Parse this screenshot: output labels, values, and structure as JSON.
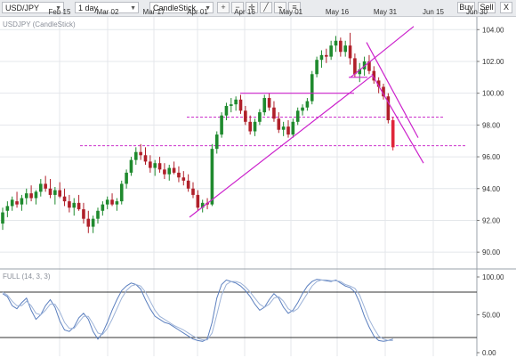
{
  "toolbar": {
    "symbol": "USD/JPY",
    "interval": "1 day",
    "chart_type": "CandleStick",
    "buy_label": "Buy",
    "sell_label": "Sell",
    "close_label": "X"
  },
  "chart_data": [
    {
      "type": "candlestick",
      "title": "USDJPY (CandleStick)",
      "x_tick_labels": [
        "Feb 15",
        "Mar 02",
        "Mar 17",
        "Apr 01",
        "Apr 16",
        "May 01",
        "May 16",
        "May 31",
        "Jun 15",
        "Jun 30"
      ],
      "y_tick_labels": [
        "104.00",
        "102.00",
        "100.00",
        "98.00",
        "96.00",
        "94.00",
        "92.00",
        "90.00"
      ],
      "ylim": [
        89,
        104.8
      ],
      "grid": true,
      "candles": [
        [
          91.8,
          92.8,
          91.4,
          92.5
        ],
        [
          92.6,
          93.2,
          92.2,
          92.9
        ],
        [
          92.9,
          93.5,
          92.6,
          93.3
        ],
        [
          93.2,
          93.8,
          92.8,
          93.0
        ],
        [
          93.0,
          93.6,
          92.6,
          93.4
        ],
        [
          93.4,
          94.0,
          93.0,
          93.7
        ],
        [
          93.7,
          94.2,
          93.2,
          93.4
        ],
        [
          93.4,
          93.9,
          93.0,
          93.8
        ],
        [
          93.8,
          94.6,
          93.5,
          94.3
        ],
        [
          94.3,
          94.8,
          93.8,
          94.0
        ],
        [
          94.0,
          94.6,
          93.4,
          93.6
        ],
        [
          93.6,
          94.1,
          93.0,
          93.9
        ],
        [
          93.9,
          94.4,
          93.4,
          93.5
        ],
        [
          93.5,
          94.0,
          92.9,
          93.2
        ],
        [
          93.2,
          93.6,
          92.5,
          92.8
        ],
        [
          92.8,
          93.4,
          92.3,
          93.1
        ],
        [
          93.1,
          93.6,
          92.6,
          92.7
        ],
        [
          92.7,
          93.1,
          91.8,
          92.1
        ],
        [
          92.1,
          92.6,
          91.2,
          91.6
        ],
        [
          91.6,
          92.3,
          91.2,
          92.1
        ],
        [
          92.1,
          92.8,
          91.8,
          92.6
        ],
        [
          92.6,
          93.2,
          92.3,
          93.0
        ],
        [
          93.0,
          93.5,
          92.7,
          93.3
        ],
        [
          93.3,
          93.7,
          92.9,
          93.0
        ],
        [
          93.0,
          93.4,
          92.6,
          93.2
        ],
        [
          93.2,
          94.5,
          93.0,
          94.3
        ],
        [
          94.3,
          95.2,
          94.0,
          95.0
        ],
        [
          95.0,
          96.0,
          94.8,
          95.8
        ],
        [
          95.8,
          96.6,
          95.5,
          96.3
        ],
        [
          96.3,
          96.8,
          95.8,
          96.1
        ],
        [
          96.1,
          96.6,
          95.5,
          95.7
        ],
        [
          95.7,
          96.1,
          95.0,
          95.3
        ],
        [
          95.3,
          95.8,
          94.8,
          95.6
        ],
        [
          95.6,
          96.0,
          95.0,
          95.2
        ],
        [
          95.2,
          95.6,
          94.6,
          94.9
        ],
        [
          94.9,
          95.5,
          94.5,
          95.3
        ],
        [
          95.3,
          95.7,
          94.9,
          95.0
        ],
        [
          95.0,
          95.4,
          94.4,
          94.7
        ],
        [
          94.7,
          95.1,
          94.2,
          94.5
        ],
        [
          94.5,
          94.9,
          93.8,
          94.0
        ],
        [
          94.0,
          94.4,
          93.4,
          93.6
        ],
        [
          93.6,
          93.9,
          92.6,
          92.8
        ],
        [
          92.8,
          93.3,
          92.5,
          93.1
        ],
        [
          93.1,
          93.4,
          92.7,
          93.0
        ],
        [
          93.0,
          96.8,
          92.9,
          96.5
        ],
        [
          96.5,
          97.6,
          96.2,
          97.4
        ],
        [
          97.4,
          98.8,
          97.2,
          98.6
        ],
        [
          98.6,
          99.4,
          98.3,
          99.2
        ],
        [
          99.2,
          99.7,
          98.8,
          99.3
        ],
        [
          99.3,
          99.8,
          98.9,
          99.6
        ],
        [
          99.6,
          99.9,
          98.7,
          98.9
        ],
        [
          98.9,
          99.2,
          98.0,
          98.2
        ],
        [
          98.2,
          98.6,
          97.4,
          97.6
        ],
        [
          97.6,
          98.4,
          97.3,
          98.2
        ],
        [
          98.2,
          99.0,
          98.0,
          98.8
        ],
        [
          98.8,
          99.9,
          98.6,
          99.7
        ],
        [
          99.7,
          100.0,
          98.9,
          99.1
        ],
        [
          99.1,
          99.5,
          98.2,
          98.4
        ],
        [
          98.4,
          98.8,
          97.5,
          97.7
        ],
        [
          97.7,
          98.2,
          97.3,
          97.9
        ],
        [
          97.9,
          98.3,
          97.2,
          97.4
        ],
        [
          97.4,
          98.4,
          97.2,
          98.2
        ],
        [
          98.2,
          99.1,
          98.0,
          98.9
        ],
        [
          98.9,
          99.3,
          98.6,
          99.1
        ],
        [
          99.1,
          99.7,
          98.9,
          99.5
        ],
        [
          99.5,
          101.4,
          99.3,
          101.2
        ],
        [
          101.2,
          102.3,
          101.0,
          102.1
        ],
        [
          102.1,
          102.7,
          101.6,
          102.4
        ],
        [
          102.4,
          102.8,
          101.9,
          102.3
        ],
        [
          102.3,
          103.3,
          102.1,
          103.0
        ],
        [
          103.0,
          103.6,
          102.6,
          103.3
        ],
        [
          103.3,
          103.5,
          102.3,
          102.6
        ],
        [
          102.6,
          103.3,
          102.3,
          103.0
        ],
        [
          103.0,
          103.8,
          101.8,
          102.2
        ],
        [
          102.2,
          102.5,
          101.0,
          101.2
        ],
        [
          101.2,
          101.9,
          100.7,
          101.5
        ],
        [
          101.5,
          102.3,
          101.1,
          102.0
        ],
        [
          102.0,
          102.4,
          101.2,
          101.4
        ],
        [
          101.4,
          101.7,
          100.6,
          100.8
        ],
        [
          100.8,
          101.0,
          100.0,
          100.4
        ],
        [
          100.4,
          100.6,
          99.6,
          99.8
        ],
        [
          99.8,
          100.0,
          98.1,
          98.3
        ],
        [
          98.3,
          98.5,
          96.4,
          96.6
        ]
      ],
      "trendlines": [
        {
          "from": [
            "Apr 01 area",
            92.2
          ],
          "to": [
            "May 20 area",
            101.1
          ]
        },
        {
          "from": [
            "Apr 18 area",
            100.0
          ],
          "to": [
            "May 06 area",
            100.0
          ]
        },
        {
          "from": [
            "May 21 area",
            101.0
          ],
          "to": [
            "Jun 14 area",
            104.2
          ]
        },
        {
          "from": [
            "May 22 area",
            103.2
          ],
          "to": [
            "Jun 12 area",
            97.2
          ]
        },
        {
          "from": [
            "May 22 area",
            101.2
          ],
          "to": [
            "Jun 14 area",
            95.6
          ]
        }
      ],
      "horizontal_dashed_levels": [
        98.5,
        96.7
      ]
    },
    {
      "type": "line",
      "title": "FULL (14, 3, 3)",
      "y_tick_labels": [
        "100.00",
        "50.00",
        "0.00"
      ],
      "ylim": [
        0,
        100
      ],
      "levels": [
        80,
        20
      ],
      "series": [
        {
          "values": [
            78,
            74,
            62,
            58,
            66,
            72,
            56,
            44,
            50,
            62,
            70,
            60,
            42,
            30,
            28,
            34,
            46,
            52,
            44,
            28,
            18,
            26,
            40,
            56,
            70,
            82,
            88,
            92,
            90,
            84,
            70,
            58,
            48,
            44,
            40,
            38,
            34,
            30,
            26,
            22,
            18,
            16,
            15,
            18,
            40,
            72,
            90,
            96,
            94,
            92,
            88,
            82,
            74,
            64,
            56,
            60,
            70,
            78,
            72,
            60,
            52,
            56,
            66,
            78,
            88,
            94,
            97,
            96,
            95,
            94,
            96,
            92,
            88,
            86,
            80,
            66,
            48,
            34,
            22,
            16,
            15,
            16,
            18
          ]
        },
        {
          "values": [
            80,
            76,
            68,
            62,
            62,
            68,
            62,
            52,
            50,
            56,
            64,
            64,
            54,
            40,
            32,
            32,
            40,
            48,
            48,
            38,
            26,
            24,
            32,
            44,
            58,
            72,
            82,
            88,
            90,
            88,
            80,
            68,
            56,
            48,
            44,
            40,
            36,
            33,
            30,
            26,
            22,
            19,
            17,
            17,
            26,
            50,
            76,
            90,
            94,
            94,
            92,
            87,
            80,
            72,
            64,
            60,
            64,
            72,
            74,
            68,
            58,
            54,
            58,
            68,
            78,
            88,
            94,
            96,
            96,
            95,
            95,
            94,
            90,
            88,
            85,
            76,
            60,
            44,
            32,
            22,
            18,
            16,
            16
          ]
        }
      ]
    }
  ]
}
